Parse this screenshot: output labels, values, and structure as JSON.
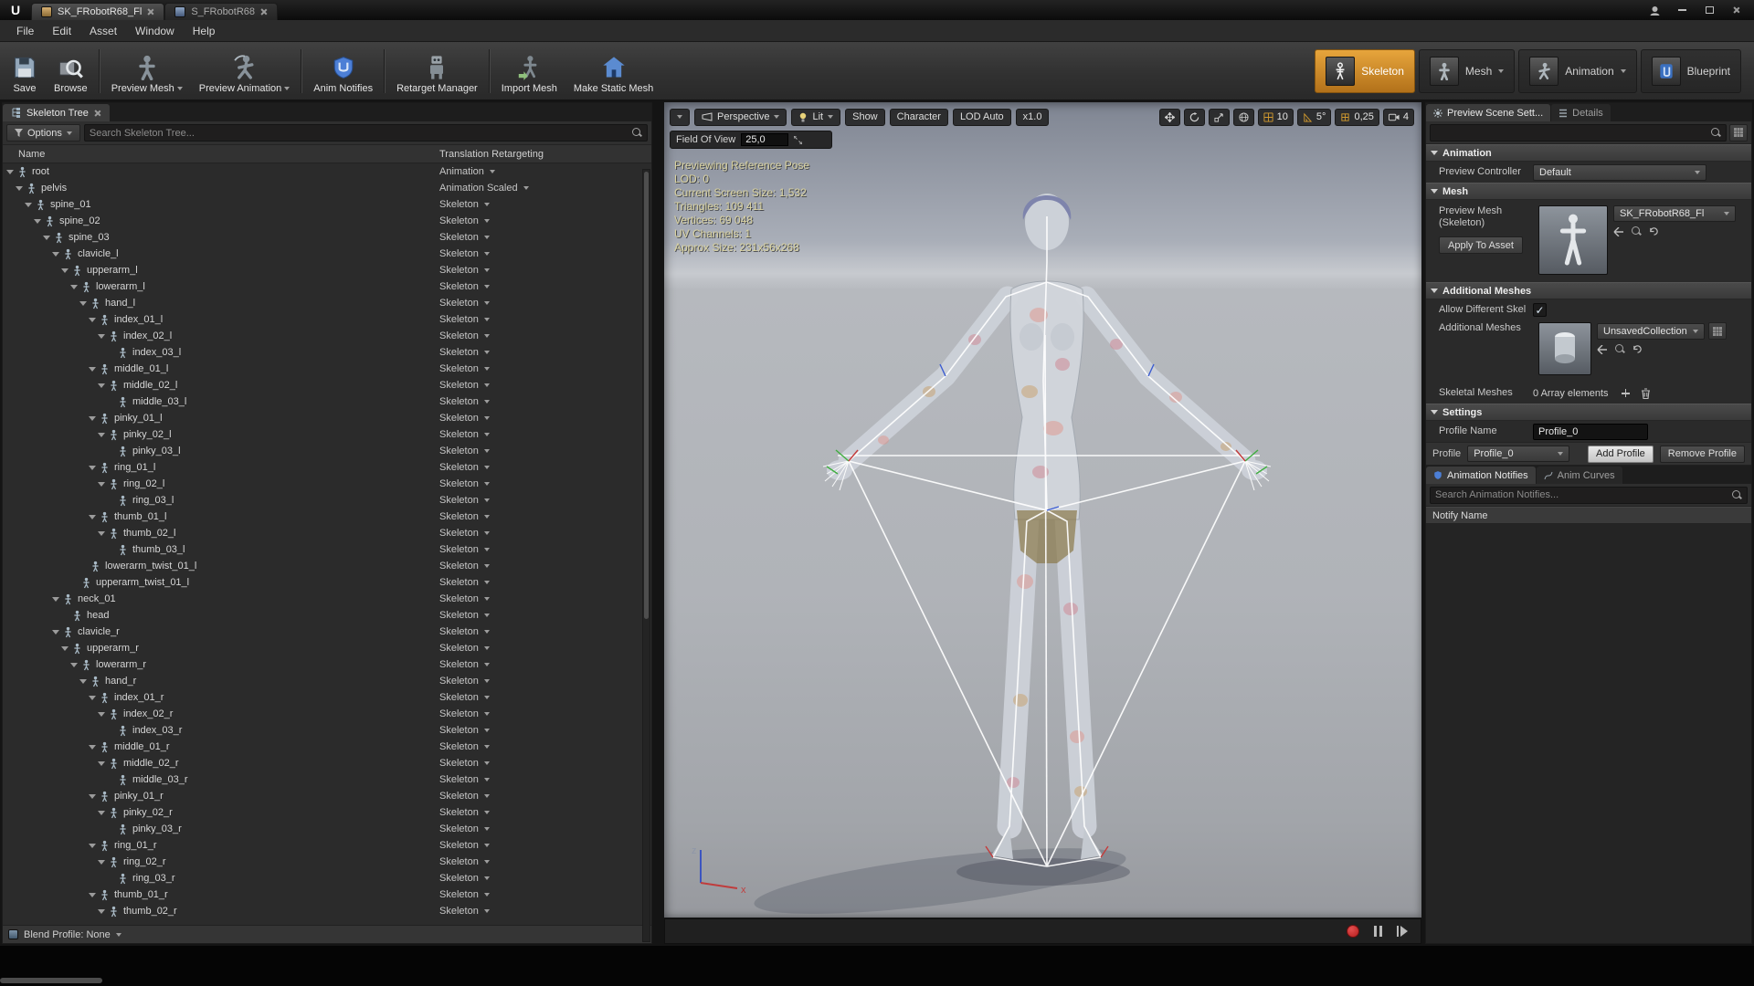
{
  "colors": {
    "accent_orange": "#cf8a1d",
    "record_red": "#cc2222",
    "notify_blue": "#4a7fd6"
  },
  "window": {
    "tabs": [
      {
        "label": "SK_FRobotR68_Fl"
      },
      {
        "label": "S_FRobotR68"
      }
    ],
    "menu": [
      "File",
      "Edit",
      "Asset",
      "Window",
      "Help"
    ]
  },
  "toolbar": {
    "buttons": [
      {
        "label": "Save"
      },
      {
        "label": "Browse"
      },
      {
        "label": "Preview Mesh"
      },
      {
        "label": "Preview Animation"
      },
      {
        "label": "Anim Notifies"
      },
      {
        "label": "Retarget Manager"
      },
      {
        "label": "Import Mesh"
      },
      {
        "label": "Make Static Mesh"
      }
    ],
    "modes": [
      {
        "label": "Skeleton"
      },
      {
        "label": "Mesh"
      },
      {
        "label": "Animation"
      },
      {
        "label": "Blueprint"
      }
    ]
  },
  "skeleton_tree": {
    "tab_label": "Skeleton Tree",
    "options_label": "Options",
    "search_placeholder": "Search Skeleton Tree...",
    "columns": {
      "name": "Name",
      "retargeting": "Translation Retargeting"
    },
    "blend_profile": "Blend Profile: None",
    "bones": [
      {
        "name": "root",
        "level": 0,
        "retargeting": "Animation"
      },
      {
        "name": "pelvis",
        "level": 1,
        "retargeting": "Animation Scaled"
      },
      {
        "name": "spine_01",
        "level": 2,
        "retargeting": "Skeleton"
      },
      {
        "name": "spine_02",
        "level": 3,
        "retargeting": "Skeleton"
      },
      {
        "name": "spine_03",
        "level": 4,
        "retargeting": "Skeleton"
      },
      {
        "name": "clavicle_l",
        "level": 5,
        "retargeting": "Skeleton"
      },
      {
        "name": "upperarm_l",
        "level": 6,
        "retargeting": "Skeleton"
      },
      {
        "name": "lowerarm_l",
        "level": 7,
        "retargeting": "Skeleton"
      },
      {
        "name": "hand_l",
        "level": 8,
        "retargeting": "Skeleton"
      },
      {
        "name": "index_01_l",
        "level": 9,
        "retargeting": "Skeleton"
      },
      {
        "name": "index_02_l",
        "level": 10,
        "retargeting": "Skeleton"
      },
      {
        "name": "index_03_l",
        "level": 11,
        "retargeting": "Skeleton",
        "leaf": true
      },
      {
        "name": "middle_01_l",
        "level": 9,
        "retargeting": "Skeleton"
      },
      {
        "name": "middle_02_l",
        "level": 10,
        "retargeting": "Skeleton"
      },
      {
        "name": "middle_03_l",
        "level": 11,
        "retargeting": "Skeleton",
        "leaf": true
      },
      {
        "name": "pinky_01_l",
        "level": 9,
        "retargeting": "Skeleton"
      },
      {
        "name": "pinky_02_l",
        "level": 10,
        "retargeting": "Skeleton"
      },
      {
        "name": "pinky_03_l",
        "level": 11,
        "retargeting": "Skeleton",
        "leaf": true
      },
      {
        "name": "ring_01_l",
        "level": 9,
        "retargeting": "Skeleton"
      },
      {
        "name": "ring_02_l",
        "level": 10,
        "retargeting": "Skeleton"
      },
      {
        "name": "ring_03_l",
        "level": 11,
        "retargeting": "Skeleton",
        "leaf": true
      },
      {
        "name": "thumb_01_l",
        "level": 9,
        "retargeting": "Skeleton"
      },
      {
        "name": "thumb_02_l",
        "level": 10,
        "retargeting": "Skeleton"
      },
      {
        "name": "thumb_03_l",
        "level": 11,
        "retargeting": "Skeleton",
        "leaf": true
      },
      {
        "name": "lowerarm_twist_01_l",
        "level": 8,
        "retargeting": "Skeleton",
        "leaf": true
      },
      {
        "name": "upperarm_twist_01_l",
        "level": 7,
        "retargeting": "Skeleton",
        "leaf": true
      },
      {
        "name": "neck_01",
        "level": 5,
        "retargeting": "Skeleton"
      },
      {
        "name": "head",
        "level": 6,
        "retargeting": "Skeleton",
        "leaf": true
      },
      {
        "name": "clavicle_r",
        "level": 5,
        "retargeting": "Skeleton"
      },
      {
        "name": "upperarm_r",
        "level": 6,
        "retargeting": "Skeleton"
      },
      {
        "name": "lowerarm_r",
        "level": 7,
        "retargeting": "Skeleton"
      },
      {
        "name": "hand_r",
        "level": 8,
        "retargeting": "Skeleton"
      },
      {
        "name": "index_01_r",
        "level": 9,
        "retargeting": "Skeleton"
      },
      {
        "name": "index_02_r",
        "level": 10,
        "retargeting": "Skeleton"
      },
      {
        "name": "index_03_r",
        "level": 11,
        "retargeting": "Skeleton",
        "leaf": true
      },
      {
        "name": "middle_01_r",
        "level": 9,
        "retargeting": "Skeleton"
      },
      {
        "name": "middle_02_r",
        "level": 10,
        "retargeting": "Skeleton"
      },
      {
        "name": "middle_03_r",
        "level": 11,
        "retargeting": "Skeleton",
        "leaf": true
      },
      {
        "name": "pinky_01_r",
        "level": 9,
        "retargeting": "Skeleton"
      },
      {
        "name": "pinky_02_r",
        "level": 10,
        "retargeting": "Skeleton"
      },
      {
        "name": "pinky_03_r",
        "level": 11,
        "retargeting": "Skeleton",
        "leaf": true
      },
      {
        "name": "ring_01_r",
        "level": 9,
        "retargeting": "Skeleton"
      },
      {
        "name": "ring_02_r",
        "level": 10,
        "retargeting": "Skeleton"
      },
      {
        "name": "ring_03_r",
        "level": 11,
        "retargeting": "Skeleton",
        "leaf": true
      },
      {
        "name": "thumb_01_r",
        "level": 9,
        "retargeting": "Skeleton"
      },
      {
        "name": "thumb_02_r",
        "level": 10,
        "retargeting": "Skeleton"
      }
    ]
  },
  "viewport": {
    "toolbar": {
      "perspective": "Perspective",
      "lit": "Lit",
      "show": "Show",
      "character": "Character",
      "lod": "LOD Auto",
      "speed": "x1.0",
      "grid_snap": "10",
      "angle_snap": "5°",
      "scale_snap": "0,25",
      "camera_speed": "4"
    },
    "fov": {
      "label": "Field Of View",
      "value": "25,0"
    },
    "stats": [
      "Previewing Reference Pose",
      "LOD: 0",
      "Current Screen Size: 1,532",
      "Triangles: 109 411",
      "Vertices: 69 048",
      "UV Channels: 1",
      "Approx Size: 231x56x268"
    ],
    "gizmo": {
      "x": "x",
      "z": "z"
    }
  },
  "details": {
    "tabs": [
      {
        "label": "Preview Scene Sett..."
      },
      {
        "label": "Details"
      }
    ],
    "search_placeholder": "",
    "animation": {
      "title": "Animation",
      "preview_controller_label": "Preview Controller",
      "preview_controller_value": "Default"
    },
    "mesh": {
      "title": "Mesh",
      "preview_mesh_label": "Preview Mesh (Skeleton)",
      "preview_mesh_value": "SK_FRobotR68_Fl",
      "apply_button": "Apply To Asset"
    },
    "additional_meshes": {
      "title": "Additional Meshes",
      "allow_label": "Allow Different Skel",
      "meshes_label": "Additional Meshes",
      "collection_value": "UnsavedCollection",
      "skeletal_label": "Skeletal Meshes",
      "skeletal_value": "0 Array elements"
    },
    "settings": {
      "title": "Settings",
      "profile_name_label": "Profile Name",
      "profile_name_value": "Profile_0"
    },
    "profile_bar": {
      "label": "Profile",
      "value": "Profile_0",
      "add": "Add Profile",
      "remove": "Remove Profile"
    }
  },
  "notifies": {
    "tabs": [
      {
        "label": "Animation Notifies"
      },
      {
        "label": "Anim Curves"
      }
    ],
    "search_placeholder": "Search Animation Notifies...",
    "column_header": "Notify Name"
  }
}
